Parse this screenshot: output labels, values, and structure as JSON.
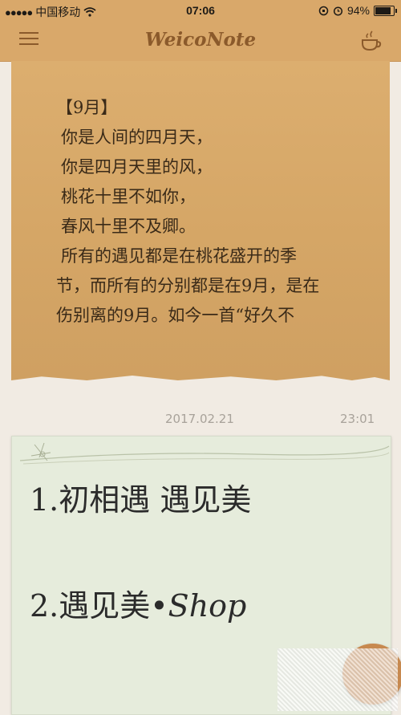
{
  "status_bar": {
    "carrier": "中国移动",
    "time": "07:06",
    "battery_percent": "94%",
    "battery_level": 0.94
  },
  "nav": {
    "title": "WeicoNote",
    "menu_icon": "hamburger-menu-icon",
    "right_icon": "coffee-cup-icon"
  },
  "notes": [
    {
      "lines": [
        "【9月】",
        "你是人间的四月天，",
        "你是四月天里的风，",
        "桃花十里不如你，",
        "春风十里不及卿。",
        "所有的遇见都是在桃花盛开的季",
        "节，而所有的分别都是在9月，是在",
        "伤别离的9月。如今一首“好久不"
      ],
      "date": "2017.02.21",
      "time": "23:01",
      "color": "#d9aa6b"
    },
    {
      "item1": "1.初相遇 遇见美",
      "item2_prefix": "2.遇见美•",
      "item2_suffix": "Shop",
      "color": "#e6ecdc"
    }
  ],
  "colors": {
    "accent": "#d9a86a",
    "nav_icon": "#8b5a2b"
  }
}
